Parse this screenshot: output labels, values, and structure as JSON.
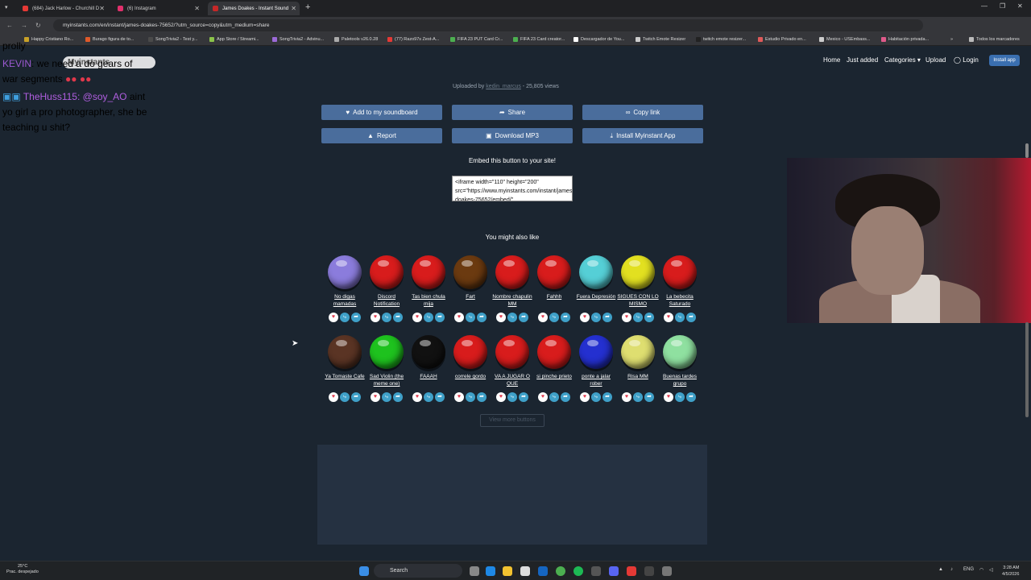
{
  "browser": {
    "tabs": [
      {
        "title": "(684) Jack Harlow - Churchill D",
        "color": "#e53935"
      },
      {
        "title": "(6) Instagram",
        "color": "#e1306c"
      },
      {
        "title": "James Doakes - Instant Sound",
        "color": "#c62828"
      }
    ],
    "url": "myinstants.com/en/instant/james-doakes-75652/?utm_source=copy&utm_medium=share",
    "bookmarks": [
      "Happy Cristiano Ro...",
      "Burago figura de to...",
      "SongTrivia2 - Test y...",
      "App Store / Streami...",
      "SongTrivia2 - Advinu...",
      "Paletools v26.0.28",
      "(77) Razo97s Zest-A...",
      "FIFA 23 PUT Card Cr...",
      "FIFA 23 Card creator...",
      "Descargador de You...",
      "Twitch Emote Resizer",
      "twitch emote resizer...",
      "Estudio Privado en...",
      "Mexico - USEmbass...",
      "Habitación privada..."
    ],
    "all_bookmarks": "Todos los marcadores"
  },
  "site_nav": {
    "home": "Home",
    "just_added": "Just added",
    "categories": "Categories",
    "upload": "Upload",
    "login": "Login",
    "install": "Install app"
  },
  "upload_meta": {
    "prefix": "Uploaded by",
    "uploader": "kedin_marcus",
    "views": "- 25,805 views"
  },
  "actions": {
    "add": "Add to my soundboard",
    "share": "Share",
    "copy": "Copy link",
    "report": "Report",
    "download": "Download MP3",
    "install": "Install Myinstant App"
  },
  "embed": {
    "title": "Embed this button to your site!",
    "code": "<iframe width=\"110\" height=\"200\" src=\"https://www.myinstants.com/instant/james-doakes-75652/embed/\""
  },
  "also_like": {
    "title": "You might also like",
    "row1": [
      {
        "label": "No digas mamadas",
        "color": "#8b7cdc"
      },
      {
        "label": "Discord Notification",
        "color": "#d81c1c"
      },
      {
        "label": "Tas bien chula mija",
        "color": "#d81c1c"
      },
      {
        "label": "Fart",
        "color": "#6b3a10"
      },
      {
        "label": "Nombre chapulin MM",
        "color": "#d81c1c"
      },
      {
        "label": "Fahhh",
        "color": "#d81c1c"
      },
      {
        "label": "Fuera Depresión",
        "color": "#55cfd6"
      },
      {
        "label": "SIGUES CON LO MISMO",
        "color": "#e2e020"
      },
      {
        "label": "La bebecita Saturado",
        "color": "#d81c1c"
      }
    ],
    "row2": [
      {
        "label": "Ya Tomaste Cafe",
        "color": "#5a3424"
      },
      {
        "label": "Sad Violin (the meme one)",
        "color": "#1ec21e"
      },
      {
        "label": "FAAAH",
        "color": "#111111"
      },
      {
        "label": "correle gordo",
        "color": "#d81c1c"
      },
      {
        "label": "VA A JUGAR O QUE",
        "color": "#d81c1c"
      },
      {
        "label": "si pinche prieto",
        "color": "#d81c1c"
      },
      {
        "label": "ponte a jalar rober",
        "color": "#2430d0"
      },
      {
        "label": "Risa MM",
        "color": "#dede70"
      },
      {
        "label": "Buenas tardes grupo",
        "color": "#8fe0a0"
      }
    ],
    "view_more": "View more buttons"
  },
  "chat": {
    "overlay_pill": "Myinstants",
    "line1": "prolly",
    "line2_user": "KEVIN",
    "line2_text": ": we need a do gears of",
    "line3": "war segments",
    "line4_user": "TheHuss115",
    "line4_mention": ": @soy_AO",
    "line4_text": " aint",
    "line5": "yo girl a pro photographer, she be",
    "line6": "teaching u shit?"
  },
  "taskbar": {
    "temp": "25°C",
    "weather": "Prac. despejado",
    "search": "Search",
    "lang": "ENG",
    "time": "3:28 AM",
    "date": "4/5/2026"
  }
}
